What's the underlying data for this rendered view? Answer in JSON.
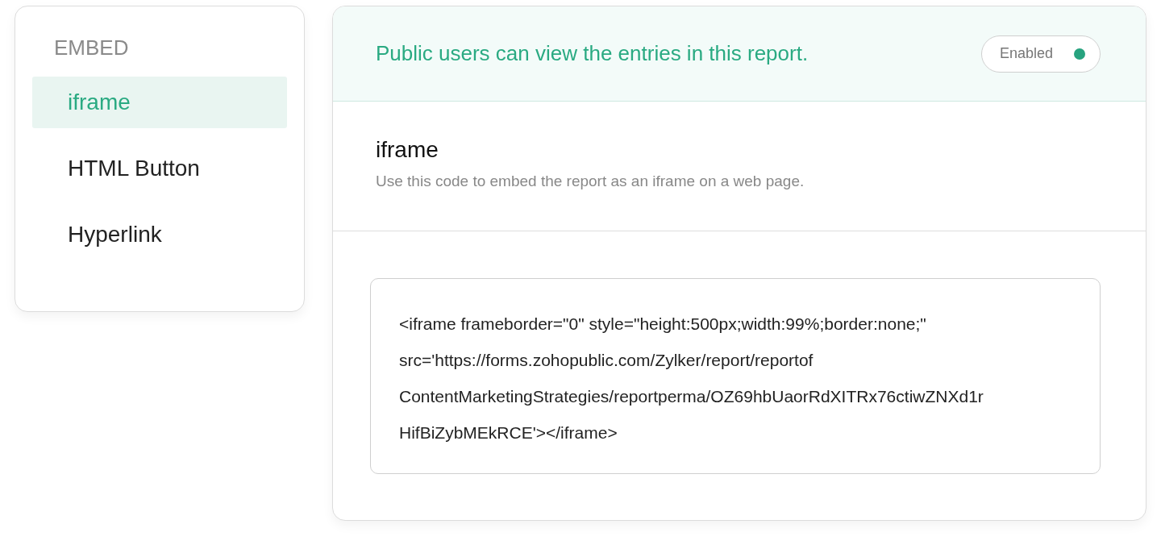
{
  "sidebar": {
    "heading": "EMBED",
    "items": [
      {
        "label": "iframe",
        "selected": true
      },
      {
        "label": "HTML Button",
        "selected": false
      },
      {
        "label": "Hyperlink",
        "selected": false
      }
    ]
  },
  "access": {
    "message": "Public users can view the entries in this report.",
    "toggle": {
      "label": "Enabled",
      "on": true
    }
  },
  "section": {
    "title": "iframe",
    "description": "Use this code to embed the report as an iframe on a web page."
  },
  "code_lines": [
    "<iframe frameborder=\"0\" style=\"height:500px;width:99%;border:none;\"",
    "src='https://forms.zohopublic.com/Zylker/report/reportof",
    "ContentMarketingStrategies/reportperma/OZ69hbUaorRdXITRx76ctiwZNXd1r",
    "HifBiZybMEkRCE'></iframe>"
  ]
}
